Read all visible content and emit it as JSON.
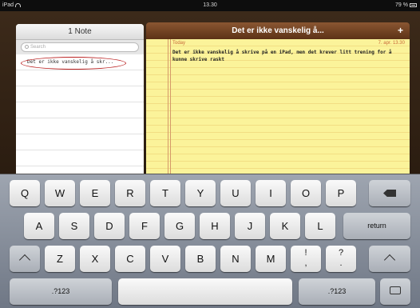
{
  "status_bar": {
    "device": "iPad",
    "time": "13.30",
    "battery": "79 %"
  },
  "notes_list": {
    "title": "1 Note",
    "search_placeholder": "Search",
    "notes": [
      {
        "title": "Det er ikke vanskelig å skr..."
      }
    ]
  },
  "note": {
    "header_title": "Det er ikke vanskelig å...",
    "add_label": "+",
    "day": "Today",
    "date": "7. apr.  13.30",
    "body": "Det er ikke vanskelig å skrive på en iPad, men det krever litt trening for å kunne skrive raskt"
  },
  "keyboard": {
    "row1": [
      "Q",
      "W",
      "E",
      "R",
      "T",
      "Y",
      "U",
      "I",
      "O",
      "P"
    ],
    "row2": [
      "A",
      "S",
      "D",
      "F",
      "G",
      "H",
      "J",
      "K",
      "L"
    ],
    "row3": [
      "Z",
      "X",
      "C",
      "V",
      "B",
      "N",
      "M"
    ],
    "punct1": "!\n,",
    "punct2": "?\n.",
    "return_label": "return",
    "numbers_label": ".?123"
  },
  "colors": {
    "paper": "#fbf39a",
    "header_brown": "#6b3d1e",
    "margin_line": "#d59a6a"
  }
}
